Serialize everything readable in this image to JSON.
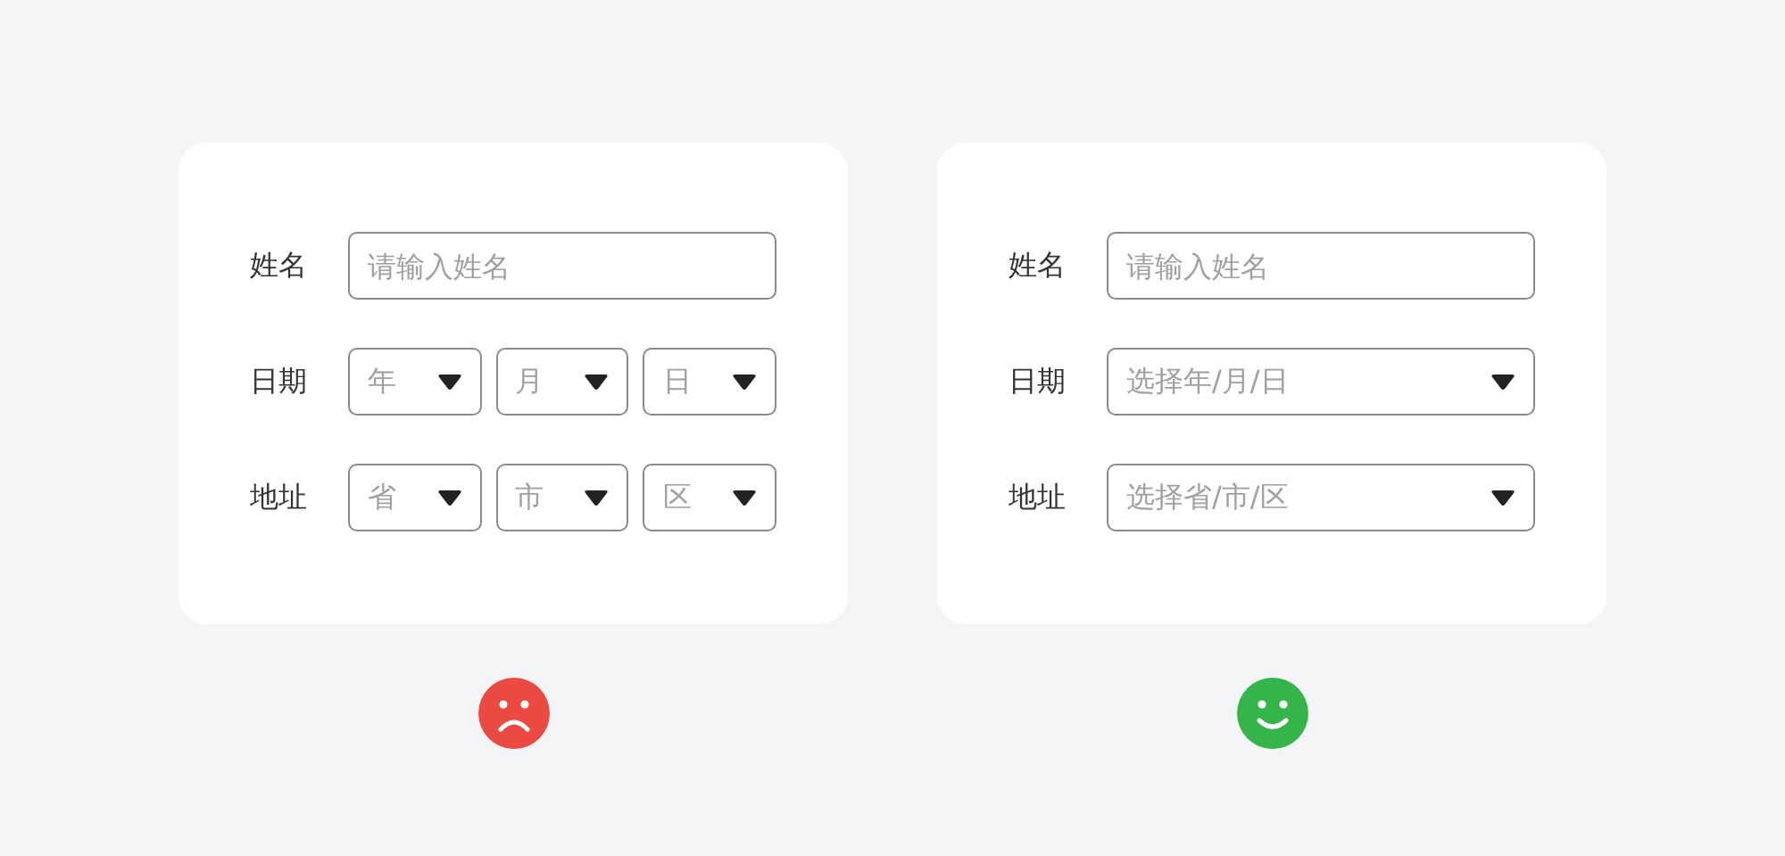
{
  "panels": [
    {
      "face": {
        "kind": "sad"
      },
      "rows": [
        {
          "label": "姓名",
          "kind": "text",
          "fields": [
            {
              "placeholder": "请输入姓名"
            }
          ]
        },
        {
          "label": "日期",
          "kind": "select",
          "fields": [
            {
              "placeholder": "年"
            },
            {
              "placeholder": "月"
            },
            {
              "placeholder": "日"
            }
          ]
        },
        {
          "label": "地址",
          "kind": "select",
          "fields": [
            {
              "placeholder": "省"
            },
            {
              "placeholder": "市"
            },
            {
              "placeholder": "区"
            }
          ]
        }
      ]
    },
    {
      "face": {
        "kind": "happy"
      },
      "rows": [
        {
          "label": "姓名",
          "kind": "text",
          "fields": [
            {
              "placeholder": "请输入姓名"
            }
          ]
        },
        {
          "label": "日期",
          "kind": "select",
          "fields": [
            {
              "placeholder": "选择年/月/日"
            }
          ]
        },
        {
          "label": "地址",
          "kind": "select",
          "fields": [
            {
              "placeholder": "选择省/市/区"
            }
          ]
        }
      ]
    }
  ]
}
